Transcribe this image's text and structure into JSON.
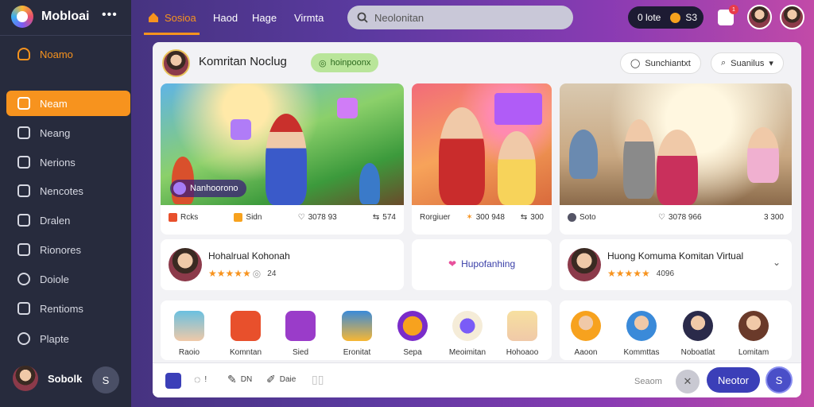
{
  "app": {
    "name": "Mobloai"
  },
  "sidebar": {
    "items": [
      {
        "label": "Noamo"
      },
      {
        "label": "Neam"
      },
      {
        "label": "Neang"
      },
      {
        "label": "Nerions"
      },
      {
        "label": "Nencotes"
      },
      {
        "label": "Dralen"
      },
      {
        "label": "Rionores"
      },
      {
        "label": "Doiole"
      },
      {
        "label": "Rentioms"
      },
      {
        "label": "Plapte"
      }
    ],
    "user": {
      "name": "Sobolk",
      "badge": "S"
    }
  },
  "topbar": {
    "tabs": [
      "Sosioa",
      "Haod",
      "Hage",
      "Virmta"
    ],
    "search_placeholder": "Neolonitan",
    "pill_a": "0 lote",
    "pill_b": "S3",
    "notif_count": "1"
  },
  "header": {
    "title": "Komritan Noclug",
    "tag": "hoinpoonx",
    "btn1": "Sunchiantxt",
    "btn2": "Suanilus"
  },
  "cards": [
    {
      "overlay": "Nanhoorono",
      "stats": [
        "Rcks",
        "Sidn",
        "3078 93",
        "574"
      ]
    },
    {
      "stats": [
        "Rorgiuer",
        "300 948",
        "300"
      ]
    },
    {
      "stats": [
        "Soto",
        "3078 966",
        "3 300"
      ]
    }
  ],
  "profiles": [
    {
      "name": "Hohalrual Kohonah",
      "rating": "24"
    },
    {
      "label": "Hupofanhing"
    },
    {
      "name": "Huong Komuma Komitan Virtual",
      "rating": "4096"
    }
  ],
  "apps_left": [
    "Raoio",
    "Komntan",
    "Sied",
    "Eronitat",
    "Sepa",
    "Meoimitan",
    "Hohoaoo"
  ],
  "apps_right": [
    "Aaoon",
    "Kommttas",
    "Noboatlat",
    "Lomitam"
  ],
  "bottombar": {
    "item2": "!",
    "item3": "DN",
    "item4": "Daie",
    "search_label": "Seaom",
    "primary": "Neotor",
    "last_btn": "S"
  }
}
